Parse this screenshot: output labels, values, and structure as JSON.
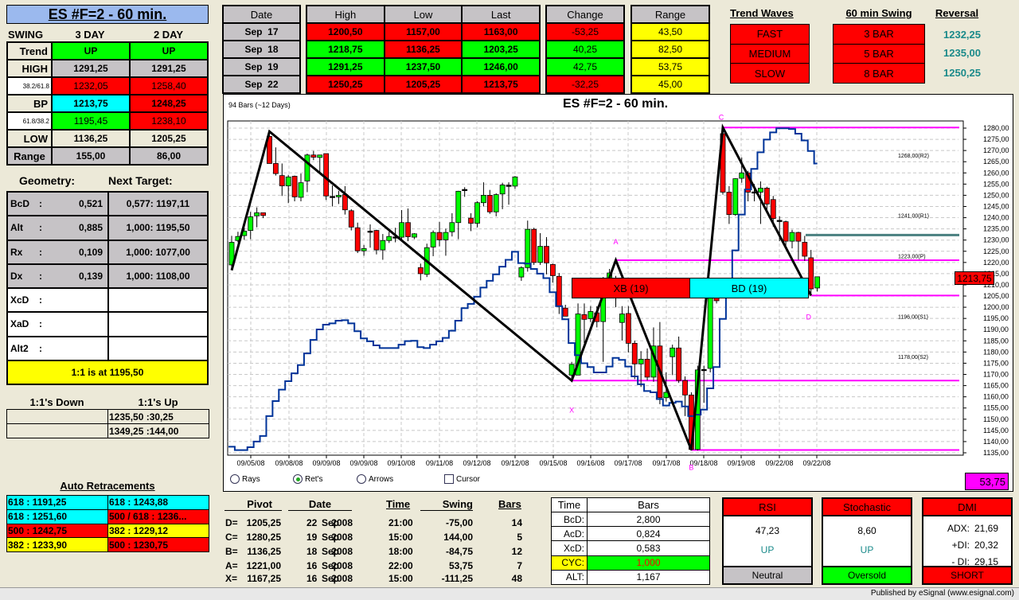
{
  "title": "ES #F=2 - 60 min.",
  "swing": {
    "label": "SWING",
    "col1": "3 DAY",
    "col2": "2 DAY",
    "rows": [
      {
        "label": "Trend",
        "v1": "UP",
        "v2": "UP"
      },
      {
        "label": "HIGH",
        "v1": "1291,25",
        "v2": "1291,25"
      },
      {
        "label": "38.2/61.8",
        "v1": "1232,05",
        "v2": "1258,40"
      },
      {
        "label": "BP",
        "v1": "1213,75",
        "v2": "1248,25"
      },
      {
        "label": "61.8/38.2",
        "v1": "1195,45",
        "v2": "1238,10"
      },
      {
        "label": "LOW",
        "v1": "1136,25",
        "v2": "1205,25"
      },
      {
        "label": "Range",
        "v1": "155,00",
        "v2": "86,00"
      }
    ]
  },
  "geometry": {
    "label": "Geometry:",
    "next_label": "Next Target:",
    "rows": [
      {
        "name": "BcD",
        "sep": ":",
        "val": "0,521",
        "target": "0,577: 1197,11"
      },
      {
        "name": "Alt",
        "sep": ":",
        "val": "0,885",
        "target": "1,000: 1195,50"
      },
      {
        "name": "Rx",
        "sep": ":",
        "val": "0,109",
        "target": "1,000: 1077,00"
      },
      {
        "name": "Dx",
        "sep": ":",
        "val": "0,139",
        "target": "1,000: 1108,00"
      },
      {
        "name": "XcD",
        "sep": ":",
        "val": "",
        "target": ""
      },
      {
        "name": "XaD",
        "sep": ":",
        "val": "",
        "target": ""
      },
      {
        "name": "Alt2",
        "sep": ":",
        "val": "",
        "target": ""
      }
    ],
    "one_to_one": "1:1 is at 1195,50"
  },
  "ones": {
    "down_label": "1:1's Down",
    "up_label": "1:1's Up",
    "up": [
      "1235,50 :30,25",
      "1349,25 :144,00"
    ]
  },
  "retracements": {
    "title": "Auto Retracements",
    "cells": [
      {
        "text": "618 : 1191,25",
        "color": "#00ffff"
      },
      {
        "text": "618 : 1243,88",
        "color": "#00ffff"
      },
      {
        "text": "618 : 1251,60",
        "color": "#00ffff"
      },
      {
        "text": "500 / 618 : 1236...",
        "color": "#ff0000"
      },
      {
        "text": "500 : 1242,75",
        "color": "#ff0000"
      },
      {
        "text": "382 : 1229,12",
        "color": "#ffff00"
      },
      {
        "text": "382 : 1233,90",
        "color": "#ffff00"
      },
      {
        "text": "500 : 1230,75",
        "color": "#ff0000"
      }
    ]
  },
  "daily": {
    "headers": [
      "Date",
      "High",
      "Low",
      "Last",
      "Change",
      "Range"
    ],
    "rows": [
      {
        "date": "Sep  17",
        "high": "1200,50",
        "low": "1157,00",
        "last": "1163,00",
        "change": "-53,25",
        "range": "43,50"
      },
      {
        "date": "Sep  18",
        "high": "1218,75",
        "low": "1136,25",
        "last": "1203,25",
        "change": "40,25",
        "range": "82,50"
      },
      {
        "date": "Sep  19",
        "high": "1291,25",
        "low": "1237,50",
        "last": "1246,00",
        "change": "42,75",
        "range": "53,75"
      },
      {
        "date": "Sep  22",
        "high": "1250,25",
        "low": "1205,25",
        "last": "1213,75",
        "change": "-32,25",
        "range": "45,00"
      }
    ]
  },
  "trend": {
    "waves_label": "Trend Waves",
    "swing_label": "60 min Swing",
    "reversal_label": "Reversal",
    "waves": [
      "FAST",
      "MEDIUM",
      "SLOW"
    ],
    "swings": [
      "3 BAR",
      "5 BAR",
      "8 BAR"
    ],
    "reversals": [
      "1232,25",
      "1235,00",
      "1250,25"
    ]
  },
  "chart_data": {
    "type": "candlestick",
    "title": "ES #F=2 - 60 min.",
    "subtitle": "94 Bars (~12 Days)",
    "ylim": [
      1135,
      1280
    ],
    "y_step": 5,
    "x_ticks": [
      "09/05/08",
      "09/08/08",
      "09/09/08",
      "09/09/08",
      "09/10/08",
      "09/11/08",
      "09/12/08",
      "09/12/08",
      "09/15/08",
      "09/16/08",
      "09/17/08",
      "09/17/08",
      "09/18/08",
      "09/19/08",
      "09/22/08",
      "09/22/08"
    ],
    "candles": [
      [
        1218.9,
        1231.9,
        1217.1,
        1229
      ],
      [
        1229.8,
        1233.7,
        1229,
        1231.6
      ],
      [
        1232,
        1235.5,
        1230.1,
        1234
      ],
      [
        1234.3,
        1242.6,
        1230.4,
        1240.4
      ],
      [
        1240.8,
        1244.6,
        1235.7,
        1242.2
      ],
      [
        1242.2,
        1242.2,
        1239.8,
        1241
      ],
      [
        1276.3,
        1278.1,
        1264.2,
        1264.2
      ],
      [
        1264.2,
        1271.4,
        1258.8,
        1259.7
      ],
      [
        1258.8,
        1264.2,
        1249.7,
        1254.2
      ],
      [
        1254.2,
        1259.1,
        1246.5,
        1258.2
      ],
      [
        1258.5,
        1258.8,
        1247.3,
        1249.3
      ],
      [
        1249.1,
        1259.7,
        1247.3,
        1255.6
      ],
      [
        1256.4,
        1268.6,
        1251.4,
        1268
      ],
      [
        1268,
        1269.8,
        1265.7,
        1267
      ],
      [
        1266.9,
        1268,
        1259.7,
        1268
      ],
      [
        1268.6,
        1268.6,
        1247.9,
        1249.7
      ],
      [
        1249.5,
        1254.4,
        1245,
        1249.3
      ],
      [
        1249.3,
        1252,
        1246.1,
        1250
      ],
      [
        1250.3,
        1254.1,
        1241.4,
        1243.5
      ],
      [
        1243.1,
        1243.8,
        1234.3,
        1235.8
      ],
      [
        1235.5,
        1237.8,
        1224.2,
        1225.2
      ],
      [
        1225.2,
        1227.8,
        1223,
        1226.2
      ],
      [
        1233.9,
        1237,
        1226.6,
        1234
      ],
      [
        1234.3,
        1234.6,
        1223.6,
        1225.6
      ],
      [
        1225.6,
        1232.7,
        1221.2,
        1229.8
      ],
      [
        1229.8,
        1233.7,
        1228.7,
        1231.6
      ],
      [
        1231.3,
        1235.5,
        1229,
        1231.4
      ],
      [
        1231.3,
        1243.4,
        1229.5,
        1237.8
      ],
      [
        1237.8,
        1244.1,
        1229.5,
        1231.5
      ],
      [
        1231.3,
        1233.1,
        1230.4,
        1232.8
      ],
      [
        1217.7,
        1219.5,
        1212,
        1215
      ],
      [
        1214.7,
        1228.4,
        1213.5,
        1226.6
      ],
      [
        1226.9,
        1234.3,
        1222.8,
        1233.4
      ],
      [
        1233.4,
        1238.1,
        1227.2,
        1230.1
      ],
      [
        1230.1,
        1235.1,
        1223,
        1233.4
      ],
      [
        1233.7,
        1242,
        1231.6,
        1237.8
      ],
      [
        1237.8,
        1252,
        1230.4,
        1251.8
      ],
      [
        1252.6,
        1253.6,
        1249.3,
        1252.5
      ],
      [
        1239.8,
        1242,
        1234,
        1237.5
      ],
      [
        1237.5,
        1247.3,
        1235.7,
        1246.7
      ],
      [
        1246.7,
        1255.8,
        1245,
        1250
      ],
      [
        1250,
        1252.4,
        1241.7,
        1242.6
      ],
      [
        1242.6,
        1250.9,
        1240.6,
        1250.3
      ],
      [
        1250.6,
        1255.6,
        1243.8,
        1254.6
      ],
      [
        1254.4,
        1255.8,
        1245.8,
        1254.5
      ],
      [
        1254.1,
        1258.6,
        1252.9,
        1258.2
      ],
      [
        1213.5,
        1218.3,
        1211.8,
        1217.7
      ],
      [
        1217.7,
        1238.7,
        1215.9,
        1234.8
      ],
      [
        1234.8,
        1235.5,
        1218.9,
        1220
      ],
      [
        1220,
        1233.1,
        1218.9,
        1227.2
      ],
      [
        1227.2,
        1231.3,
        1214.7,
        1219.8
      ],
      [
        1219.1,
        1219.5,
        1211,
        1214.1
      ],
      [
        1213.8,
        1215.3,
        1197,
        1200.3
      ],
      [
        1199.6,
        1201.1,
        1196,
        1196
      ],
      [
        1169.7,
        1175.6,
        1167.9,
        1174.5
      ],
      [
        1169.7,
        1201.7,
        1169.7,
        1197
      ],
      [
        1196.7,
        1201.7,
        1184,
        1194.6
      ],
      [
        1194.9,
        1200.5,
        1193.4,
        1198.1
      ],
      [
        1197.5,
        1200.5,
        1191,
        1193.6
      ],
      [
        1193.6,
        1213.5,
        1175.6,
        1210
      ],
      [
        1212.3,
        1217.1,
        1204.1,
        1215.3
      ],
      [
        1210,
        1214,
        1200,
        1206
      ],
      [
        1193.2,
        1200.5,
        1185.1,
        1197
      ],
      [
        1197.2,
        1200.5,
        1179.8,
        1183.9
      ],
      [
        1183.9,
        1185.1,
        1167.9,
        1174.7
      ],
      [
        1174.7,
        1180.4,
        1164.4,
        1176.8
      ],
      [
        1176.8,
        1181.6,
        1167.3,
        1168.8
      ],
      [
        1168.8,
        1191,
        1166.7,
        1182.7
      ],
      [
        1182.7,
        1193.4,
        1156.7,
        1159.6
      ],
      [
        1159.6,
        1170.9,
        1157.9,
        1162
      ],
      [
        1177.9,
        1183.3,
        1169.7,
        1181.8
      ],
      [
        1181.8,
        1186.9,
        1166.2,
        1167.3
      ],
      [
        1167.3,
        1169.1,
        1151.4,
        1160.8
      ],
      [
        1160.8,
        1162,
        1136,
        1136.5
      ],
      [
        1136.5,
        1173.9,
        1136,
        1172
      ],
      [
        1172.1,
        1173.9,
        1157.3,
        1172.2
      ],
      [
        1172.7,
        1207.6,
        1170.9,
        1205.3
      ],
      [
        1205.3,
        1207.6,
        1201.7,
        1202.9
      ],
      [
        1277.5,
        1279.9,
        1250.3,
        1251.4
      ],
      [
        1251.4,
        1254.1,
        1237.2,
        1241.4
      ],
      [
        1241.4,
        1257.6,
        1240.8,
        1257.4
      ],
      [
        1257.6,
        1266.9,
        1255.6,
        1260
      ],
      [
        1260,
        1260.9,
        1247.3,
        1251.4
      ],
      [
        1251.4,
        1255,
        1247.3,
        1251.5
      ],
      [
        1251.4,
        1256.2,
        1237.2,
        1253.2
      ],
      [
        1253.2,
        1253.8,
        1243.2,
        1246.1
      ],
      [
        1248.1,
        1249.7,
        1236,
        1239.6
      ],
      [
        1238.7,
        1240.6,
        1229.5,
        1238.8
      ],
      [
        1238.2,
        1238.7,
        1226.3,
        1229.5
      ],
      [
        1229.5,
        1234.6,
        1226.3,
        1233.4
      ],
      [
        1233.4,
        1233.7,
        1221.2,
        1229.5
      ],
      [
        1229,
        1231.9,
        1220.7,
        1222.8
      ],
      [
        1222.1,
        1225.6,
        1205.3,
        1208.2
      ],
      [
        1208.6,
        1213.5,
        1207,
        1213.6
      ]
    ],
    "indicator_line": [
      1137.7,
      1136.2,
      1136.2,
      1137.5,
      1140,
      1142.5,
      1151.4,
      1158.1,
      1163.2,
      1167,
      1170.5,
      1174.2,
      1179.4,
      1185.4,
      1190.1,
      1192.2,
      1192.8,
      1194,
      1194.2,
      1192.8,
      1189.3,
      1186.1,
      1184.8,
      1183,
      1181.8,
      1181.8,
      1181.8,
      1183.3,
      1184.9,
      1185,
      1182.2,
      1181.8,
      1183.3,
      1184.8,
      1186.3,
      1189.5,
      1194,
      1199.6,
      1201.5,
      1204.7,
      1208.8,
      1211.8,
      1214.7,
      1218.1,
      1221.2,
      1224.8,
      1219.7,
      1219.5,
      1217.1,
      1215,
      1213,
      1206.7,
      1200.5,
      1194.6,
      1184,
      1178.6,
      1175,
      1173.3,
      1170.9,
      1170.9,
      1173.5,
      1177.4,
      1176.5,
      1173.5,
      1169.1,
      1165.6,
      1162.6,
      1162,
      1159,
      1156.1,
      1157.3,
      1157.9,
      1155.7,
      1151.4,
      1152,
      1154.3,
      1163.8,
      1173.3,
      1194.8,
      1207.6,
      1225.4,
      1241.4,
      1252.6,
      1261.8,
      1269.2,
      1274.9,
      1278.1,
      1279.9,
      1279.9,
      1279.6,
      1277.5,
      1274.5,
      1269.8,
      1264.2
    ],
    "zigzag": [
      [
        0,
        1216.5
      ],
      [
        6,
        1278.5
      ],
      [
        54,
        1167.25
      ],
      [
        61,
        1221
      ],
      [
        73,
        1136.25
      ],
      [
        78,
        1280.25
      ],
      [
        92,
        1205.25
      ]
    ],
    "pattern_points": [
      {
        "label": "X",
        "bar": 54,
        "price": 1167.25
      },
      {
        "label": "A",
        "bar": 61,
        "price": 1221
      },
      {
        "label": "B",
        "bar": 73,
        "price": 1136.25
      },
      {
        "label": "C",
        "bar": 78,
        "price": 1280.25
      },
      {
        "label": "D",
        "bar": 92,
        "price": 1205.25
      }
    ],
    "reversal_line": 1232.25,
    "pivots": [
      {
        "text": "1268,00(R2)",
        "price": 1268
      },
      {
        "text": "1241,00(R1)",
        "price": 1241
      },
      {
        "text": "1223,00(P)",
        "price": 1223
      },
      {
        "text": "1196,00(S1)",
        "price": 1196
      },
      {
        "text": "1178,00(S2)",
        "price": 1178
      }
    ],
    "last_price": "1213,75",
    "xb_label": "XB (19)",
    "bd_label": "BD (19)",
    "colors": {
      "up": "#00ff00",
      "down": "#ff0000",
      "zigzag": "#000000",
      "indicator": "#003399",
      "levels": "#ff00ff",
      "reversal": "#4a8080"
    }
  },
  "chart_controls": {
    "rays": "Rays",
    "rets": "Ret's",
    "arrows": "Arrows",
    "cursor": "Cursor",
    "range_value": "53,75"
  },
  "pivot_table": {
    "headers": [
      "Pivot",
      "Date",
      "Time",
      "Swing",
      "Bars"
    ],
    "rows": [
      {
        "p": "D=",
        "price": "1205,25",
        "day": "22",
        "mon": "Sep",
        "year": "2008",
        "time": "21:00",
        "swing": "-75,00",
        "bars": "14"
      },
      {
        "p": "C=",
        "price": "1280,25",
        "day": "19",
        "mon": "Sep",
        "year": "2008",
        "time": "15:00",
        "swing": "144,00",
        "bars": "5"
      },
      {
        "p": "B=",
        "price": "1136,25",
        "day": "18",
        "mon": "Sep",
        "year": "2008",
        "time": "18:00",
        "swing": "-84,75",
        "bars": "12"
      },
      {
        "p": "A=",
        "price": "1221,00",
        "day": "16",
        "mon": "Sep",
        "year": "2008",
        "time": "22:00",
        "swing": "53,75",
        "bars": "7"
      },
      {
        "p": "X=",
        "price": "1167,25",
        "day": "16",
        "mon": "Sep",
        "year": "2008",
        "time": "15:00",
        "swing": "-111,25",
        "bars": "48"
      }
    ]
  },
  "time_bars": {
    "h1": "Time",
    "h2": "Bars",
    "rows": [
      {
        "k": "BcD:",
        "v": "2,800"
      },
      {
        "k": "AcD:",
        "v": "0,824"
      },
      {
        "k": "XcD:",
        "v": "0,583"
      },
      {
        "k": "CYC:",
        "v": "1,000"
      },
      {
        "k": "ALT:",
        "v": "1,167"
      }
    ]
  },
  "rsi": {
    "title": "RSI",
    "value": "47,23",
    "dir": "UP",
    "status": "Neutral"
  },
  "stoch": {
    "title": "Stochastic",
    "value": "8,60",
    "dir": "UP",
    "status": "Oversold"
  },
  "dmi": {
    "title": "DMI",
    "adx_label": "ADX:",
    "adx": "21,69",
    "pdi_label": "+DI:",
    "pdi": "20,32",
    "mdi_label": "- DI:",
    "mdi": "29,15",
    "status": "SHORT"
  },
  "footer": "Published by eSignal (www.esignal.com)"
}
